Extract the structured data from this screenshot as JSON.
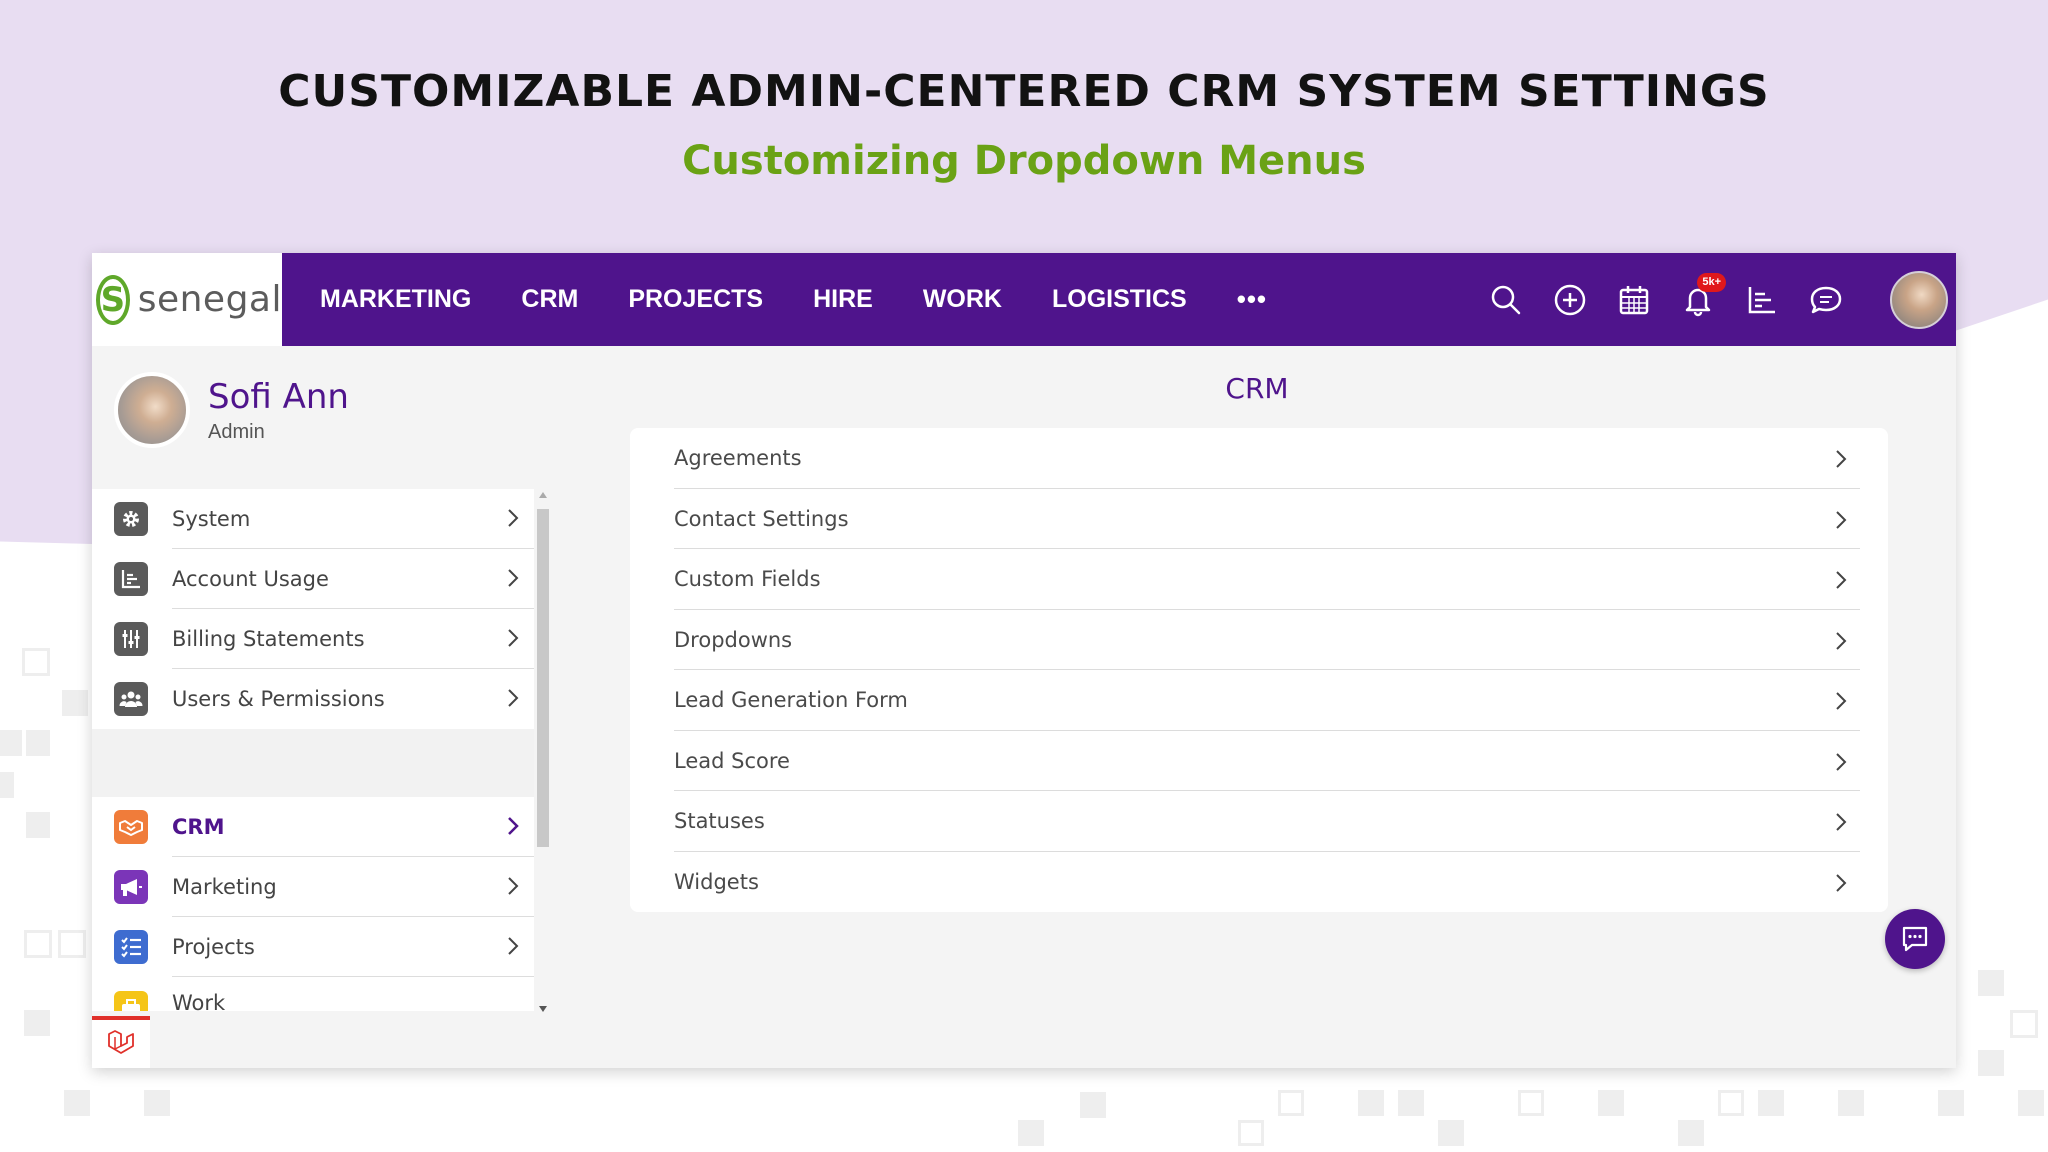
{
  "hero": {
    "title": "CUSTOMIZABLE ADMIN-CENTERED CRM SYSTEM SETTINGS",
    "subtitle": "Customizing Dropdown Menus"
  },
  "app": {
    "logo_text": "senegal",
    "logo_mark": "S",
    "nav": [
      "MARKETING",
      "CRM",
      "PROJECTS",
      "HIRE",
      "WORK",
      "LOGISTICS"
    ],
    "nav_more": "•••",
    "notification_badge": "5k+",
    "icons": [
      "search-icon",
      "add-circle-icon",
      "calendar-icon",
      "bell-icon",
      "reports-icon",
      "chat-icon"
    ]
  },
  "profile": {
    "name": "Sofi Ann",
    "role": "Admin"
  },
  "sidebar": {
    "top_items": [
      {
        "label": "System",
        "icon": "gear-icon",
        "color": "#5b5b5b"
      },
      {
        "label": "Account Usage",
        "icon": "chart-icon",
        "color": "#5b5b5b"
      },
      {
        "label": "Billing Statements",
        "icon": "sliders-icon",
        "color": "#5b5b5b"
      },
      {
        "label": "Users & Permissions",
        "icon": "users-icon",
        "color": "#5b5b5b"
      }
    ],
    "app_items": [
      {
        "label": "CRM",
        "icon": "handshake-icon",
        "color": "#f07c3a",
        "active": true
      },
      {
        "label": "Marketing",
        "icon": "megaphone-icon",
        "color": "#7b35b8"
      },
      {
        "label": "Projects",
        "icon": "checklist-icon",
        "color": "#3e6cd0"
      },
      {
        "label": "Work",
        "icon": "briefcase-icon",
        "color": "#f5c518"
      }
    ]
  },
  "content": {
    "title": "CRM",
    "items": [
      "Agreements",
      "Contact Settings",
      "Custom Fields",
      "Dropdowns",
      "Lead Generation Form",
      "Lead Score",
      "Statuses",
      "Widgets"
    ]
  },
  "colors": {
    "brand_purple": "#4f148c",
    "accent_green": "#6aa215",
    "badge_red": "#e0181b"
  }
}
